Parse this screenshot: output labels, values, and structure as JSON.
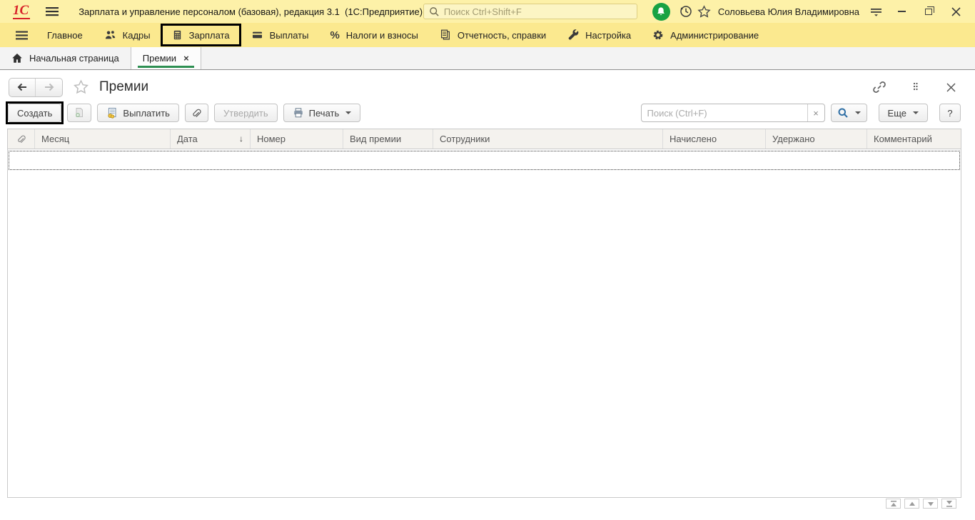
{
  "window": {
    "title": "Зарплата и управление персоналом (базовая), редакция 3.1  (1С:Предприятие)",
    "search_placeholder": "Поиск Ctrl+Shift+F",
    "user_name": "Соловьева Юлия Владимировна"
  },
  "menubar": {
    "items": [
      {
        "label": "Главное",
        "icon": "none"
      },
      {
        "label": "Кадры",
        "icon": "people-icon"
      },
      {
        "label": "Зарплата",
        "icon": "calculator-icon",
        "highlighted": true
      },
      {
        "label": "Выплаты",
        "icon": "card-icon"
      },
      {
        "label": "Налоги и взносы",
        "icon": "percent-icon",
        "glyph": "%"
      },
      {
        "label": "Отчетность, справки",
        "icon": "documents-icon"
      },
      {
        "label": "Настройка",
        "icon": "wrench-icon"
      },
      {
        "label": "Администрирование",
        "icon": "gear-icon"
      }
    ]
  },
  "tabbar": {
    "tabs": [
      {
        "label": "Начальная страница",
        "icon": "home-icon",
        "active": false
      },
      {
        "label": "Премии",
        "close_glyph": "×",
        "active": true
      }
    ]
  },
  "page": {
    "title": "Премии"
  },
  "toolbar": {
    "create_label": "Создать",
    "pay_label": "Выплатить",
    "approve_label": "Утвердить",
    "print_label": "Печать",
    "search_placeholder": "Поиск (Ctrl+F)",
    "clear_glyph": "×",
    "more_label": "Еще",
    "help_label": "?"
  },
  "table": {
    "columns": [
      "Месяц",
      "Дата",
      "Номер",
      "Вид премии",
      "Сотрудники",
      "Начислено",
      "Удержано",
      "Комментарий"
    ],
    "sort_column": "Дата",
    "sort_glyph": "↓",
    "rows": []
  },
  "colors": {
    "titlebar_bg": "#fdf1a8",
    "menubar_bg": "#fbe98f",
    "accent_green": "#2e8f52",
    "notification_green": "#18a243",
    "logo_red": "#d8232a",
    "find_button_blue": "#2f6fa5",
    "highlight_outline": "#000000"
  }
}
